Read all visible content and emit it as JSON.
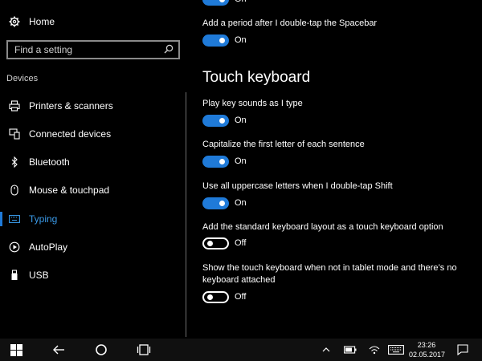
{
  "sidebar": {
    "home_label": "Home",
    "search_placeholder": "Find a setting",
    "section_label": "Devices",
    "items": [
      {
        "label": "Printers & scanners"
      },
      {
        "label": "Connected devices"
      },
      {
        "label": "Bluetooth"
      },
      {
        "label": "Mouse & touchpad"
      },
      {
        "label": "Typing"
      },
      {
        "label": "AutoPlay"
      },
      {
        "label": "USB"
      }
    ]
  },
  "main": {
    "top_toggle_state": "On",
    "period_setting": {
      "label": "Add a period after I double-tap the Spacebar",
      "state": "On"
    },
    "heading": "Touch keyboard",
    "settings": [
      {
        "label": "Play key sounds as I type",
        "state": "On"
      },
      {
        "label": "Capitalize the first letter of each sentence",
        "state": "On"
      },
      {
        "label": "Use all uppercase letters when I double-tap Shift",
        "state": "On"
      },
      {
        "label": "Add the standard keyboard layout as a touch keyboard option",
        "state": "Off"
      },
      {
        "label": "Show the touch keyboard when not in tablet mode and there’s no keyboard attached",
        "state": "Off"
      }
    ]
  },
  "taskbar": {
    "time": "23:26",
    "date": "02.05.2017"
  },
  "colors": {
    "accent": "#1f7ad8",
    "active_text": "#3a9ae8",
    "background": "#000000"
  }
}
